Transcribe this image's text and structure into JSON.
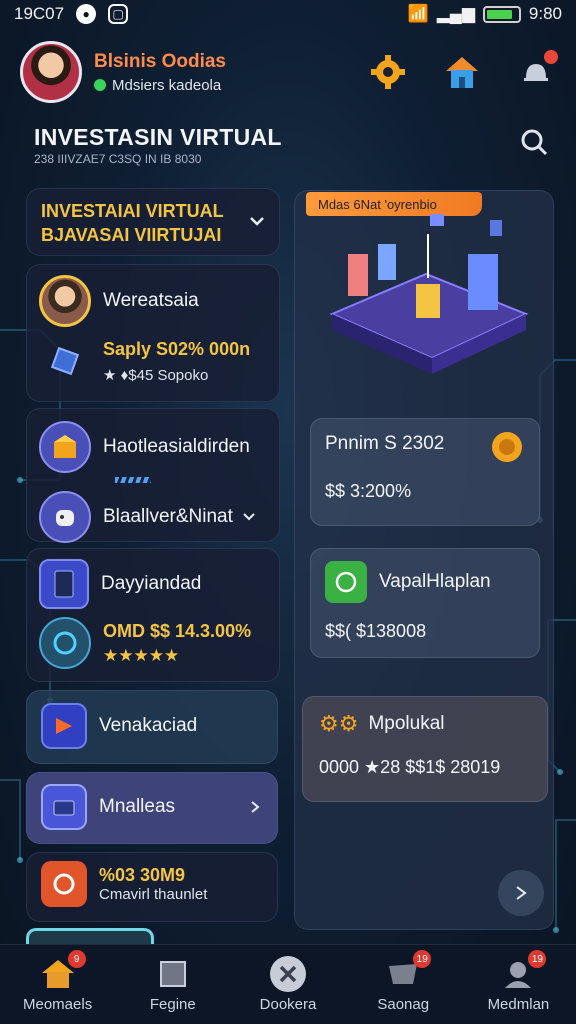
{
  "status_bar": {
    "time": "19C07",
    "right_time": "9:80"
  },
  "header": {
    "user_name": "Blsinis Oodias",
    "user_status": "Mdsiers kadeola"
  },
  "page": {
    "title": "INVESTASIN VIRTUAL",
    "subtitle": "238 IIIVZAE7 C3SQ IN IB 8030"
  },
  "dropdown": {
    "line1": "INVESTAIAI VIRTUAL",
    "line2": "BJAVASAI VIIRTUJAI"
  },
  "left_cards": [
    {
      "title": "Wereatsaia",
      "value": "Saply S02% 000n",
      "meta": "★ ♦$45 Sopoko"
    },
    {
      "title": "Haotleasialdirden"
    },
    {
      "title": "Blaallver&Ninat"
    },
    {
      "title": "Dayyiandad",
      "value": "OMD $$ 14.3.00%",
      "rating": "★★★★★"
    },
    {
      "title": "Venakaciad"
    },
    {
      "title": "Mnalleas"
    },
    {
      "title": "%03 30M9",
      "sub": "Cmavirl thaunlet"
    }
  ],
  "right": {
    "tag": "Mdas 6Nat 'oyrenbio",
    "card1": {
      "title": "Pnnim S 2302",
      "value": "$$ 3:200%"
    },
    "card2": {
      "title": "VapalHlaplan",
      "value": "$$( $138008"
    },
    "card3": {
      "title": "Mpolukal",
      "value": "0000  ★28  $$1$ 28019"
    }
  },
  "bottom_nav": [
    {
      "label": "Meomaels",
      "badge": "9"
    },
    {
      "label": "Fegine",
      "badge": ""
    },
    {
      "label": "Dookera",
      "badge": ""
    },
    {
      "label": "Saonag",
      "badge": "19"
    },
    {
      "label": "Medmlan",
      "badge": "19"
    }
  ],
  "colors": {
    "accent": "#f4c542",
    "brand": "#ff8c48",
    "success": "#37d35a"
  }
}
